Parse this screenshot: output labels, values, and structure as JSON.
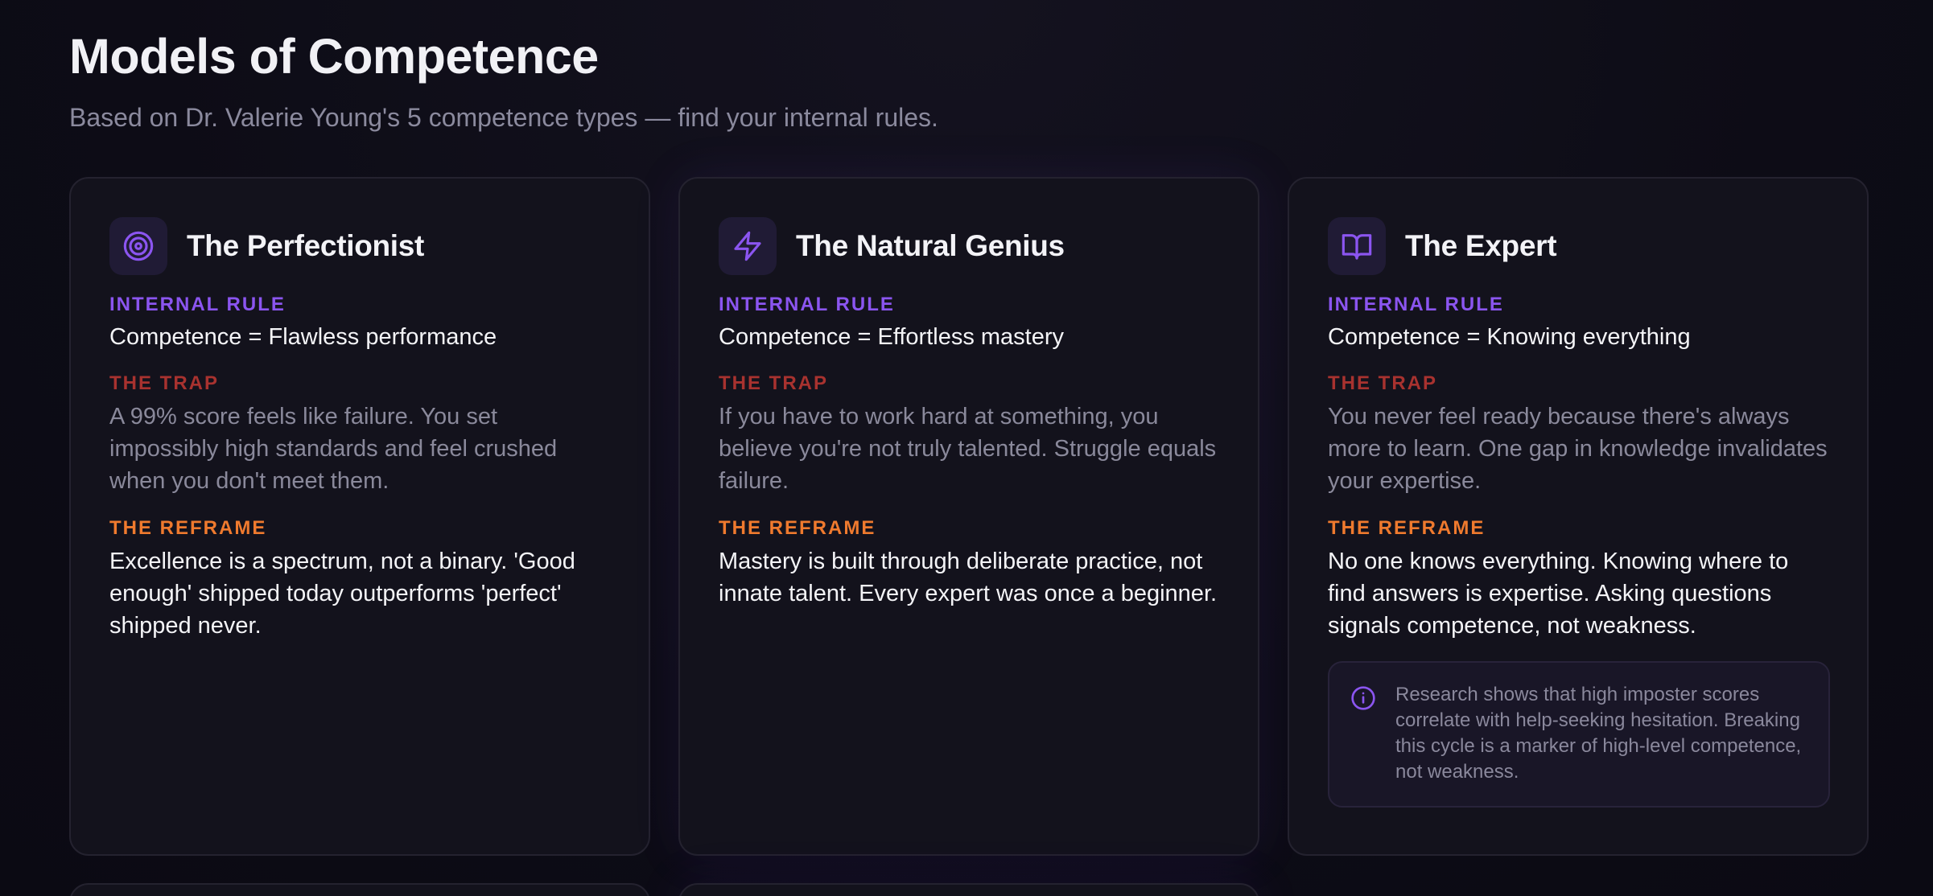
{
  "header": {
    "title": "Models of Competence",
    "subtitle": "Based on Dr. Valerie Young's 5 competence types — find your internal rules."
  },
  "labels": {
    "internal_rule": "INTERNAL RULE",
    "the_trap": "THE TRAP",
    "the_reframe": "THE REFRAME"
  },
  "colors": {
    "accent_purple": "#8b55f0",
    "trap_red": "#a8322f",
    "reframe_orange": "#ef7a2e",
    "background": "#0d0c16",
    "card_background": "#13121c"
  },
  "cards": [
    {
      "icon": "target-icon",
      "title": "The Perfectionist",
      "rule": "Competence = Flawless performance",
      "trap": "A 99% score feels like failure. You set impossibly high standards and feel crushed when you don't meet them.",
      "reframe": "Excellence is a spectrum, not a binary. 'Good enough' shipped today outperforms 'perfect' shipped never."
    },
    {
      "icon": "lightning-icon",
      "title": "The Natural Genius",
      "rule": "Competence = Effortless mastery",
      "trap": "If you have to work hard at something, you believe you're not truly talented. Struggle equals failure.",
      "reframe": "Mastery is built through deliberate practice, not innate talent. Every expert was once a beginner."
    },
    {
      "icon": "book-open-icon",
      "title": "The Expert",
      "rule": "Competence = Knowing everything",
      "trap": "You never feel ready because there's always more to learn. One gap in knowledge invalidates your expertise.",
      "reframe": "No one knows everything. Knowing where to find answers is expertise. Asking questions signals competence, not weakness.",
      "note_icon": "info-icon",
      "note": "Research shows that high imposter scores correlate with help-seeking hesitation. Breaking this cycle is a marker of high-level competence, not weakness."
    }
  ]
}
